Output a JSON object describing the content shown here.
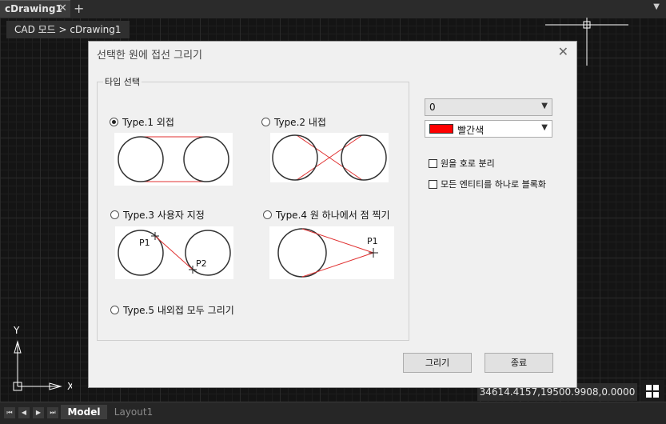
{
  "tabs": {
    "document_tab": "cDrawing1",
    "close_glyph": "✕",
    "add_glyph": "+",
    "menu_glyph": "▼"
  },
  "breadcrumb": "CAD 모드 > cDrawing1",
  "ucs": {
    "y": "Y",
    "x": "X"
  },
  "status": {
    "coords": "34614.4157,19500.9908,0.0000",
    "model_tab": "Model",
    "layout_tab": "Layout1",
    "nav": [
      "⏮",
      "◀",
      "▶",
      "⏭"
    ]
  },
  "dialog": {
    "title": "선택한 원에 접선 그리기",
    "close_glyph": "✕",
    "group_label": "타입 선택",
    "options": [
      {
        "label": "Type.1 외접",
        "checked": true
      },
      {
        "label": "Type.2 내접",
        "checked": false
      },
      {
        "label": "Type.3 사용자 지정",
        "checked": false
      },
      {
        "label": "Type.4 원 하나에서 점 찍기",
        "checked": false
      },
      {
        "label": "Type.5 내외접 모두 그리기",
        "checked": false
      }
    ],
    "point_labels": {
      "p1": "P1",
      "p2": "P2"
    },
    "layer_value": "0",
    "color_value": "빨간색",
    "color_swatch": "#ff0000",
    "checkboxes": [
      "원을 호로 분리",
      "모든 엔티티를 하나로 블록화"
    ],
    "draw_button": "그리기",
    "close_button": "종료"
  }
}
